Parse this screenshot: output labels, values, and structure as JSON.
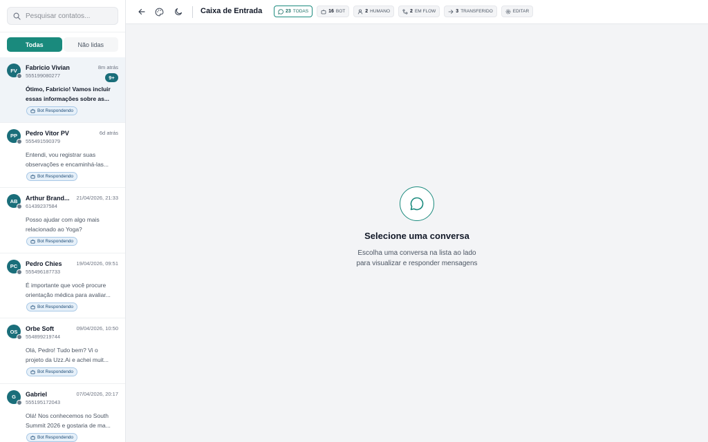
{
  "search": {
    "placeholder": "Pesquisar contatos..."
  },
  "filters": {
    "all_label": "Todas",
    "unread_label": "Não lidas"
  },
  "conversations": [
    {
      "initials": "FV",
      "name": "Fabricio Vivian",
      "time": "8m atrás",
      "phone": "555199080277",
      "unread": "9+",
      "preview": [
        "Ótimo, Fabricio! Vamos incluir",
        "essas informações sobre as..."
      ],
      "status": "Bot Respondendo"
    },
    {
      "initials": "PP",
      "name": "Pedro Vitor PV",
      "time": "6d atrás",
      "phone": "555491590379",
      "unread": "",
      "preview": [
        "Entendi, vou registrar suas",
        "observações e encaminhá-las..."
      ],
      "status": "Bot Respondendo"
    },
    {
      "initials": "AB",
      "name": "Arthur Brand...",
      "time": "21/04/2026, 21:33",
      "phone": "61439237584",
      "unread": "",
      "preview": [
        "Posso ajudar com algo mais",
        "relacionado ao Yoga?"
      ],
      "status": "Bot Respondendo"
    },
    {
      "initials": "PC",
      "name": "Pedro Chies",
      "time": "19/04/2026, 09:51",
      "phone": "555496187733",
      "unread": "",
      "preview": [
        "É importante que você procure",
        "orientação médica para avaliar..."
      ],
      "status": "Bot Respondendo"
    },
    {
      "initials": "OS",
      "name": "Orbe Soft",
      "time": "09/04/2026, 10:50",
      "phone": "554899219744",
      "unread": "",
      "preview": [
        "Olá, Pedro! Tudo bem? Vi o",
        "projeto da Uzz.Ai e achei muit..."
      ],
      "status": "Bot Respondendo"
    },
    {
      "initials": "G",
      "name": "Gabriel",
      "time": "07/04/2026, 20:17",
      "phone": "555195172043",
      "unread": "",
      "preview": [
        "Olá! Nos conhecemos no South",
        "Summit 2026 e gostaria de ma..."
      ],
      "status": "Bot Respondendo"
    }
  ],
  "header": {
    "title": "Caixa de Entrada",
    "chips": [
      {
        "count": "23",
        "label": "TODAS",
        "icon": "chat-bubble-icon"
      },
      {
        "count": "16",
        "label": "BOT",
        "icon": "bot-icon"
      },
      {
        "count": "2",
        "label": "HUMANO",
        "icon": "user-icon"
      },
      {
        "count": "2",
        "label": "EM FLOW",
        "icon": "flow-icon"
      },
      {
        "count": "3",
        "label": "TRANSFERIDO",
        "icon": "arrow-right-icon"
      },
      {
        "count": "",
        "label": "EDITAR",
        "icon": "gear-icon"
      }
    ]
  },
  "empty_state": {
    "title": "Selecione uma conversa",
    "subtitle_line1": "Escolha uma conversa na lista ao lado",
    "subtitle_line2": "para visualizar e responder mensagens"
  },
  "colors": {
    "accent": "#1a8a7d",
    "avatar": "#1a6e7a",
    "pill_bg": "#e6f0f9",
    "pill_border": "#a8c8e6"
  }
}
